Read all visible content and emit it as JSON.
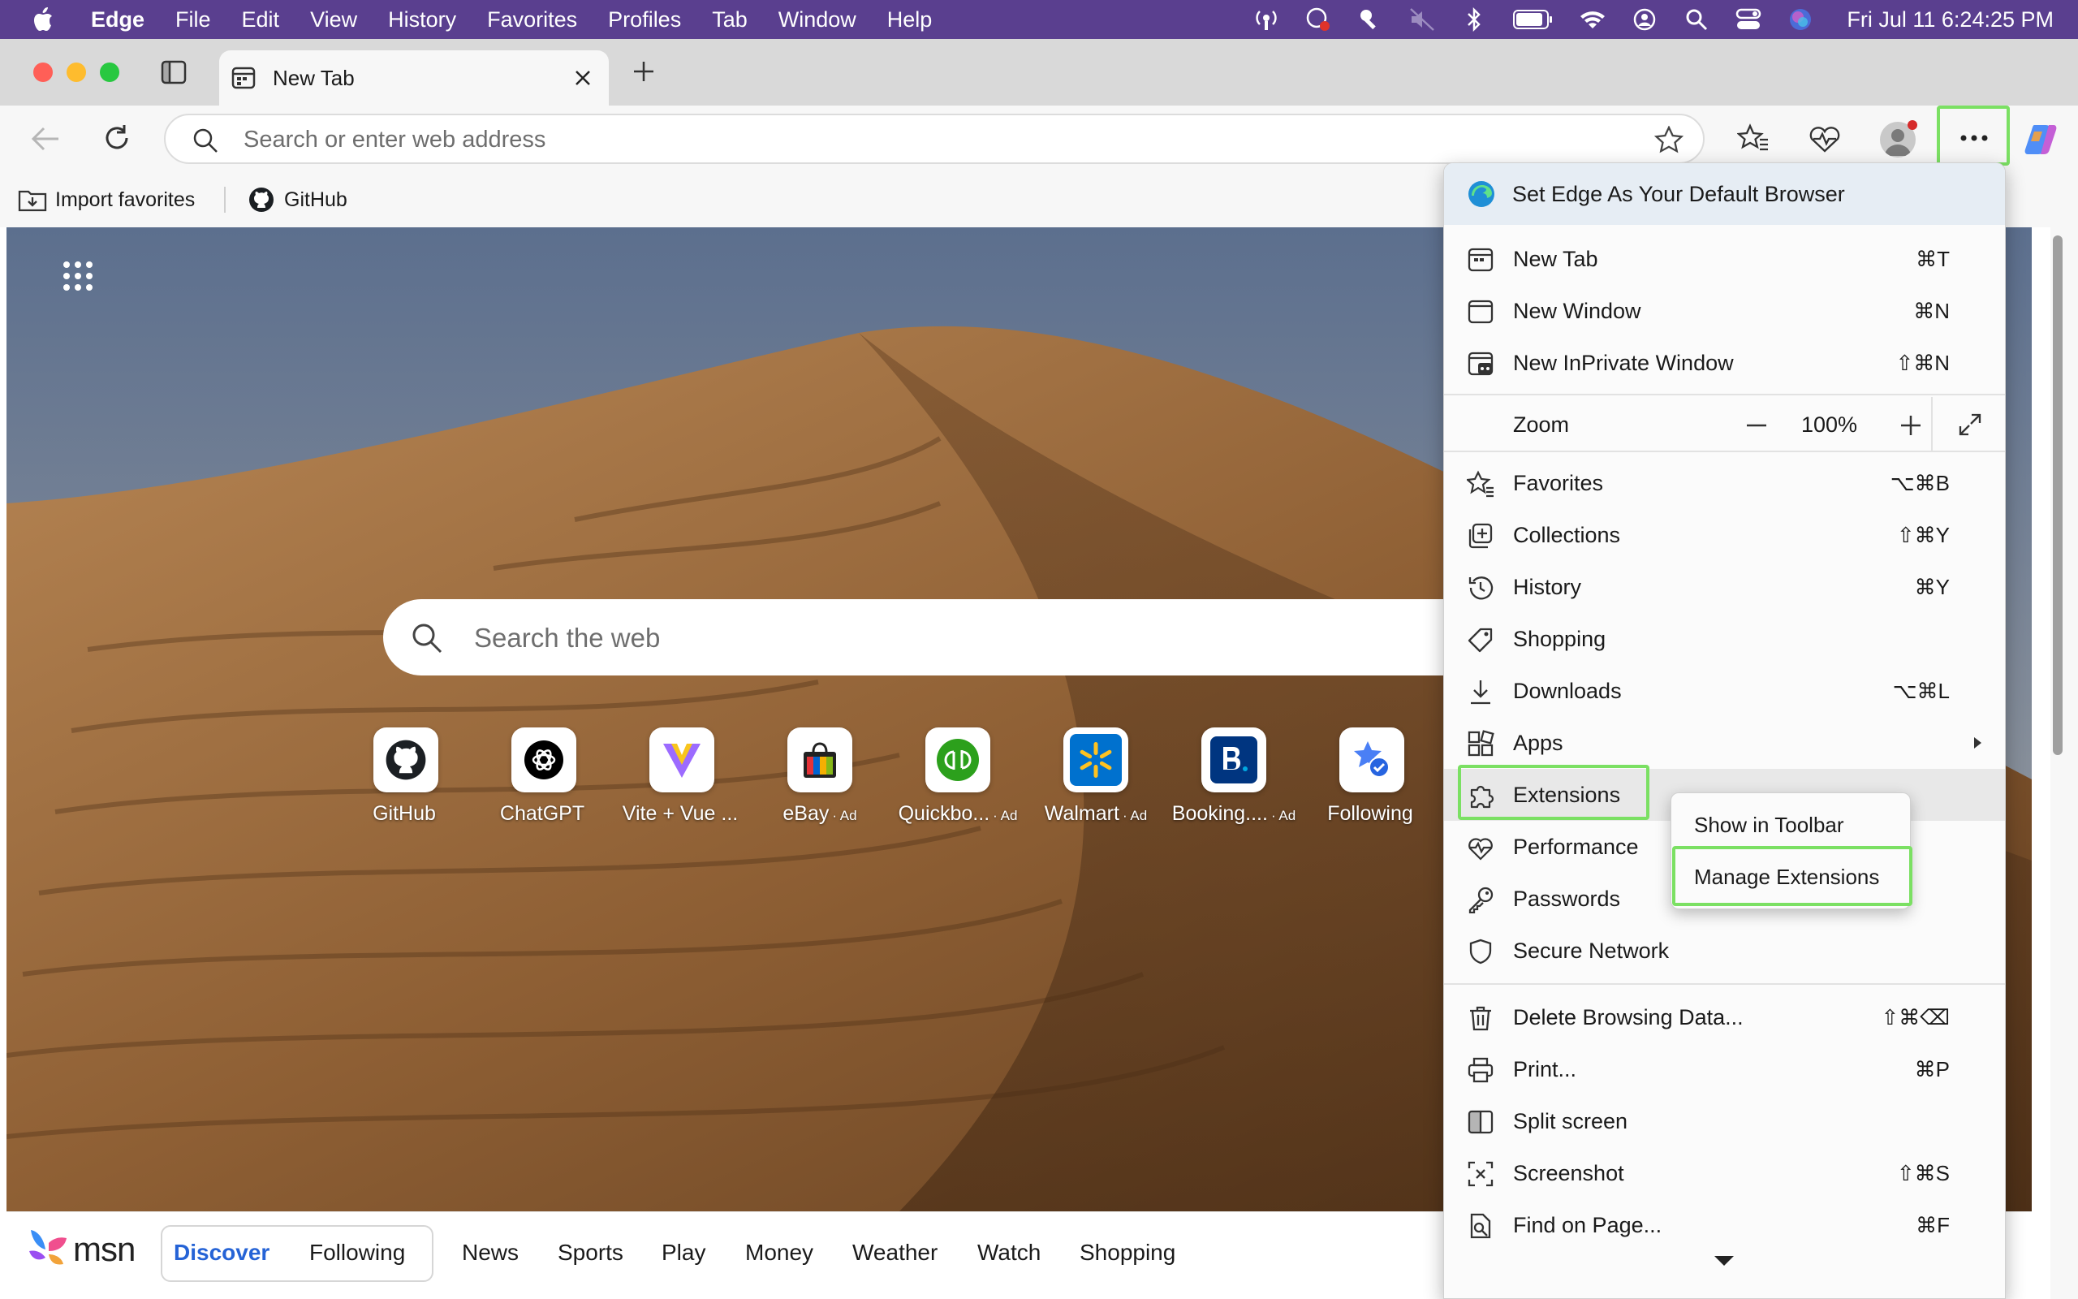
{
  "menubar": {
    "app": "Edge",
    "items": [
      "File",
      "Edit",
      "View",
      "History",
      "Favorites",
      "Profiles",
      "Tab",
      "Window",
      "Help"
    ],
    "clock": "Fri Jul 11  6:24:25 PM"
  },
  "tab": {
    "title": "New Tab"
  },
  "toolbar": {
    "address_placeholder": "Search or enter web address"
  },
  "bookmarks": {
    "import": "Import favorites",
    "github": "GitHub"
  },
  "newtab": {
    "search_placeholder": "Search the web",
    "quick_links": [
      {
        "label": "GitHub",
        "ad": ""
      },
      {
        "label": "ChatGPT",
        "ad": ""
      },
      {
        "label": "Vite + Vue ...",
        "ad": ""
      },
      {
        "label": "eBay",
        "ad": "· Ad"
      },
      {
        "label": "Quickbo...",
        "ad": "· Ad"
      },
      {
        "label": "Walmart",
        "ad": "· Ad"
      },
      {
        "label": "Booking....",
        "ad": "· Ad"
      },
      {
        "label": "Following",
        "ad": ""
      }
    ],
    "msn": {
      "logo": "msn",
      "tabs": [
        "Discover",
        "Following"
      ],
      "nav": [
        "News",
        "Sports",
        "Play",
        "Money",
        "Weather",
        "Watch",
        "Shopping"
      ]
    }
  },
  "menu": {
    "default_banner": "Set Edge As Your Default Browser",
    "items": [
      {
        "label": "New Tab",
        "shortcut": "⌘T"
      },
      {
        "label": "New Window",
        "shortcut": "⌘N"
      },
      {
        "label": "New InPrivate Window",
        "shortcut": "⇧⌘N"
      },
      {
        "label": "Favorites",
        "shortcut": "⌥⌘B"
      },
      {
        "label": "Collections",
        "shortcut": "⇧⌘Y"
      },
      {
        "label": "History",
        "shortcut": "⌘Y"
      },
      {
        "label": "Shopping",
        "shortcut": ""
      },
      {
        "label": "Downloads",
        "shortcut": "⌥⌘L"
      },
      {
        "label": "Apps",
        "shortcut": ""
      },
      {
        "label": "Extensions",
        "shortcut": ""
      },
      {
        "label": "Performance",
        "shortcut": ""
      },
      {
        "label": "Passwords",
        "shortcut": ""
      },
      {
        "label": "Secure Network",
        "shortcut": ""
      },
      {
        "label": "Delete Browsing Data...",
        "shortcut": "⇧⌘⌫"
      },
      {
        "label": "Print...",
        "shortcut": "⌘P"
      },
      {
        "label": "Split screen",
        "shortcut": ""
      },
      {
        "label": "Screenshot",
        "shortcut": "⇧⌘S"
      },
      {
        "label": "Find on Page...",
        "shortcut": "⌘F"
      }
    ],
    "zoom": {
      "label": "Zoom",
      "value": "100%"
    }
  },
  "submenu": {
    "show_in_toolbar": "Show in Toolbar",
    "manage_extensions": "Manage Extensions"
  },
  "colors": {
    "highlight": "#7be063",
    "menubar": "#5a3f8f",
    "accent": "#2a6fdb"
  }
}
